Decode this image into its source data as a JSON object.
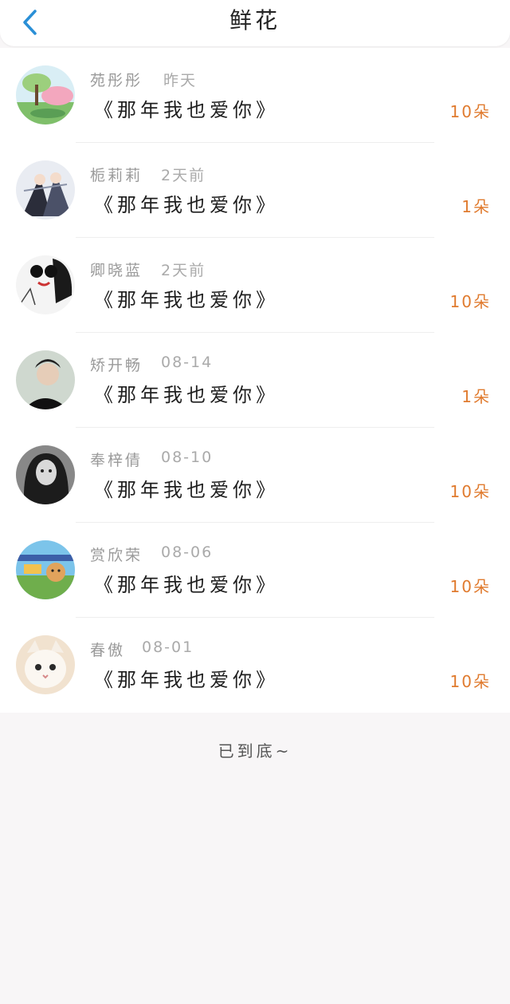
{
  "header": {
    "title": "鲜花",
    "back_icon": "chevron-left-icon",
    "accent_color": "#2a8fd6"
  },
  "colors": {
    "amount": "#e07b2f",
    "name": "#9a9a9a"
  },
  "gifts": [
    {
      "name": "苑彤彤",
      "time": "昨天",
      "book": "《那年我也爱你》",
      "amount": "10朵",
      "avatar": "landscape-tree-avatar"
    },
    {
      "name": "栀莉莉",
      "time": "2天前",
      "book": "《那年我也爱你》",
      "amount": "1朵",
      "avatar": "anime-couple-avatar"
    },
    {
      "name": "卿晓蓝",
      "time": "2天前",
      "book": "《那年我也爱你》",
      "amount": "10朵",
      "avatar": "sketch-girl-sunglasses-avatar"
    },
    {
      "name": "矫开畅",
      "time": "08-14",
      "book": "《那年我也爱你》",
      "amount": "1朵",
      "avatar": "portrait-boy-avatar"
    },
    {
      "name": "奉梓倩",
      "time": "08-10",
      "book": "《那年我也爱你》",
      "amount": "10朵",
      "avatar": "bw-girl-portrait-avatar"
    },
    {
      "name": "赏欣荣",
      "time": "08-06",
      "book": "《那年我也爱你》",
      "amount": "10朵",
      "avatar": "cartoon-cat-avatar"
    },
    {
      "name": "春傲",
      "time": "08-01",
      "book": "《那年我也爱你》",
      "amount": "10朵",
      "avatar": "white-cat-avatar"
    }
  ],
  "footer": {
    "text": "已到底~"
  }
}
